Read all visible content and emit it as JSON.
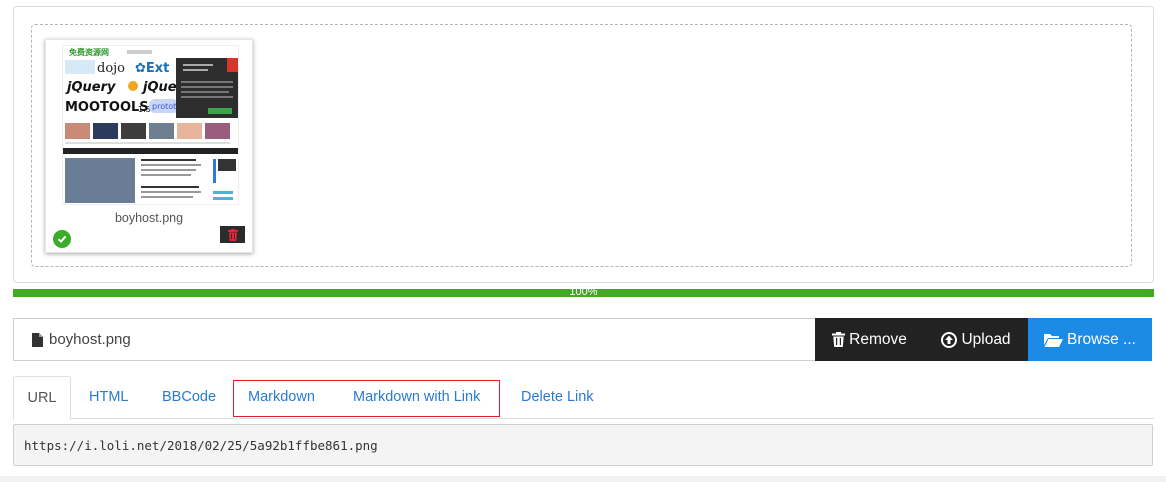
{
  "uploader": {
    "file": {
      "name": "boyhost.png",
      "status": "success"
    },
    "thumbnail": {
      "site_title": "免费资源网",
      "logos": [
        "dojo",
        "Ext",
        "jQuery",
        "jQuery",
        "MooTools 1.3",
        "prototype"
      ]
    },
    "progress": {
      "value": 1.0,
      "label": "100%"
    }
  },
  "filebar": {
    "filename": "boyhost.png",
    "remove_label": "Remove",
    "upload_label": "Upload",
    "browse_label": "Browse ..."
  },
  "tabs": [
    {
      "label": "URL",
      "active": true
    },
    {
      "label": "HTML",
      "active": false
    },
    {
      "label": "BBCode",
      "active": false
    },
    {
      "label": "Markdown",
      "active": false
    },
    {
      "label": "Markdown with Link",
      "active": false
    },
    {
      "label": "Delete Link",
      "active": false
    }
  ],
  "output": {
    "value": "https://i.loli.net/2018/02/25/5a92b1ffbe861.png"
  },
  "colors": {
    "progress": "#43a824",
    "dark_button": "#222222",
    "primary_button": "#1c8be6",
    "link": "#2a7ad1",
    "highlight": "#e02020"
  }
}
